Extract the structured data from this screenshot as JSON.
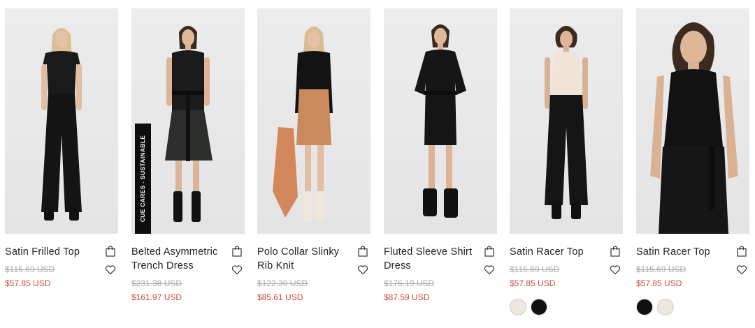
{
  "products": [
    {
      "name": "Satin Frilled Top",
      "original_price": "$115.69 USD",
      "sale_price": "$57.85 USD",
      "badge": "",
      "swatches": []
    },
    {
      "name": "Belted Asymmetric Trench Dress",
      "original_price": "$231.38 USD",
      "sale_price": "$161.97 USD",
      "badge": "CUE CARES - SUSTAINABLE",
      "swatches": []
    },
    {
      "name": "Polo Collar Slinky Rib Knit",
      "original_price": "$122.30 USD",
      "sale_price": "$85.61 USD",
      "badge": "",
      "swatches": []
    },
    {
      "name": "Fluted Sleeve Shirt Dress",
      "original_price": "$175.19 USD",
      "sale_price": "$87.59 USD",
      "badge": "",
      "swatches": []
    },
    {
      "name": "Satin Racer Top",
      "original_price": "$115.69 USD",
      "sale_price": "$57.85 USD",
      "badge": "",
      "swatches": [
        "#efe6dc",
        "#111111"
      ]
    },
    {
      "name": "Satin Racer Top",
      "original_price": "$115.69 USD",
      "sale_price": "$57.85 USD",
      "badge": "",
      "swatches": [
        "#111111",
        "#efe6dc"
      ]
    }
  ],
  "colors": {
    "sale_price": "#d04a3c",
    "original_price": "#a8a8a8",
    "badge_background": "#0d0d0d"
  }
}
